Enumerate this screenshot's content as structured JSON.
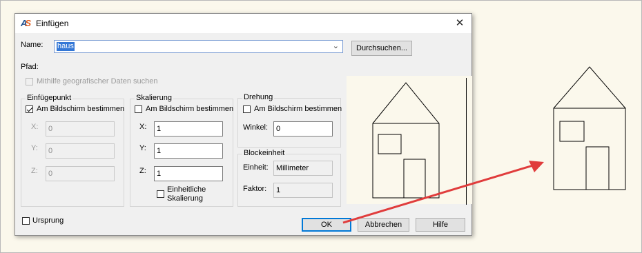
{
  "window": {
    "title": "Einfügen",
    "close_glyph": "✕"
  },
  "name_row": {
    "label": "Name:",
    "value": "haus",
    "browse_label": "Durchsuchen..."
  },
  "path": {
    "label": "Pfad:"
  },
  "geo": {
    "label": "Mithilfe geografischer Daten suchen"
  },
  "insertion": {
    "title": "Einfügepunkt",
    "onscreen_label": "Am Bildschirm bestimmen",
    "x_label": "X:",
    "x_value": "0",
    "y_label": "Y:",
    "y_value": "0",
    "z_label": "Z:",
    "z_value": "0"
  },
  "scale": {
    "title": "Skalierung",
    "onscreen_label": "Am Bildschirm bestimmen",
    "x_label": "X:",
    "x_value": "1",
    "y_label": "Y:",
    "y_value": "1",
    "z_label": "Z:",
    "z_value": "1",
    "uniform_line1": "Einheitliche",
    "uniform_line2": "Skalierung"
  },
  "rotation": {
    "title": "Drehung",
    "onscreen_label": "Am Bildschirm bestimmen",
    "angle_label": "Winkel:",
    "angle_value": "0"
  },
  "block_unit": {
    "title": "Blockeinheit",
    "unit_label": "Einheit:",
    "unit_value": "Millimeter",
    "factor_label": "Faktor:",
    "factor_value": "1"
  },
  "origin": {
    "label": "Ursprung"
  },
  "buttons": {
    "ok": "OK",
    "cancel": "Abbrechen",
    "help": "Hilfe"
  },
  "colors": {
    "arrow": "#e03c3c",
    "drawing_bg": "#fbf8ec",
    "accent": "#0078d7"
  },
  "icons": {
    "app": "autocad-logo-icon",
    "close": "close-icon",
    "dropdown": "chevron-down-icon"
  }
}
